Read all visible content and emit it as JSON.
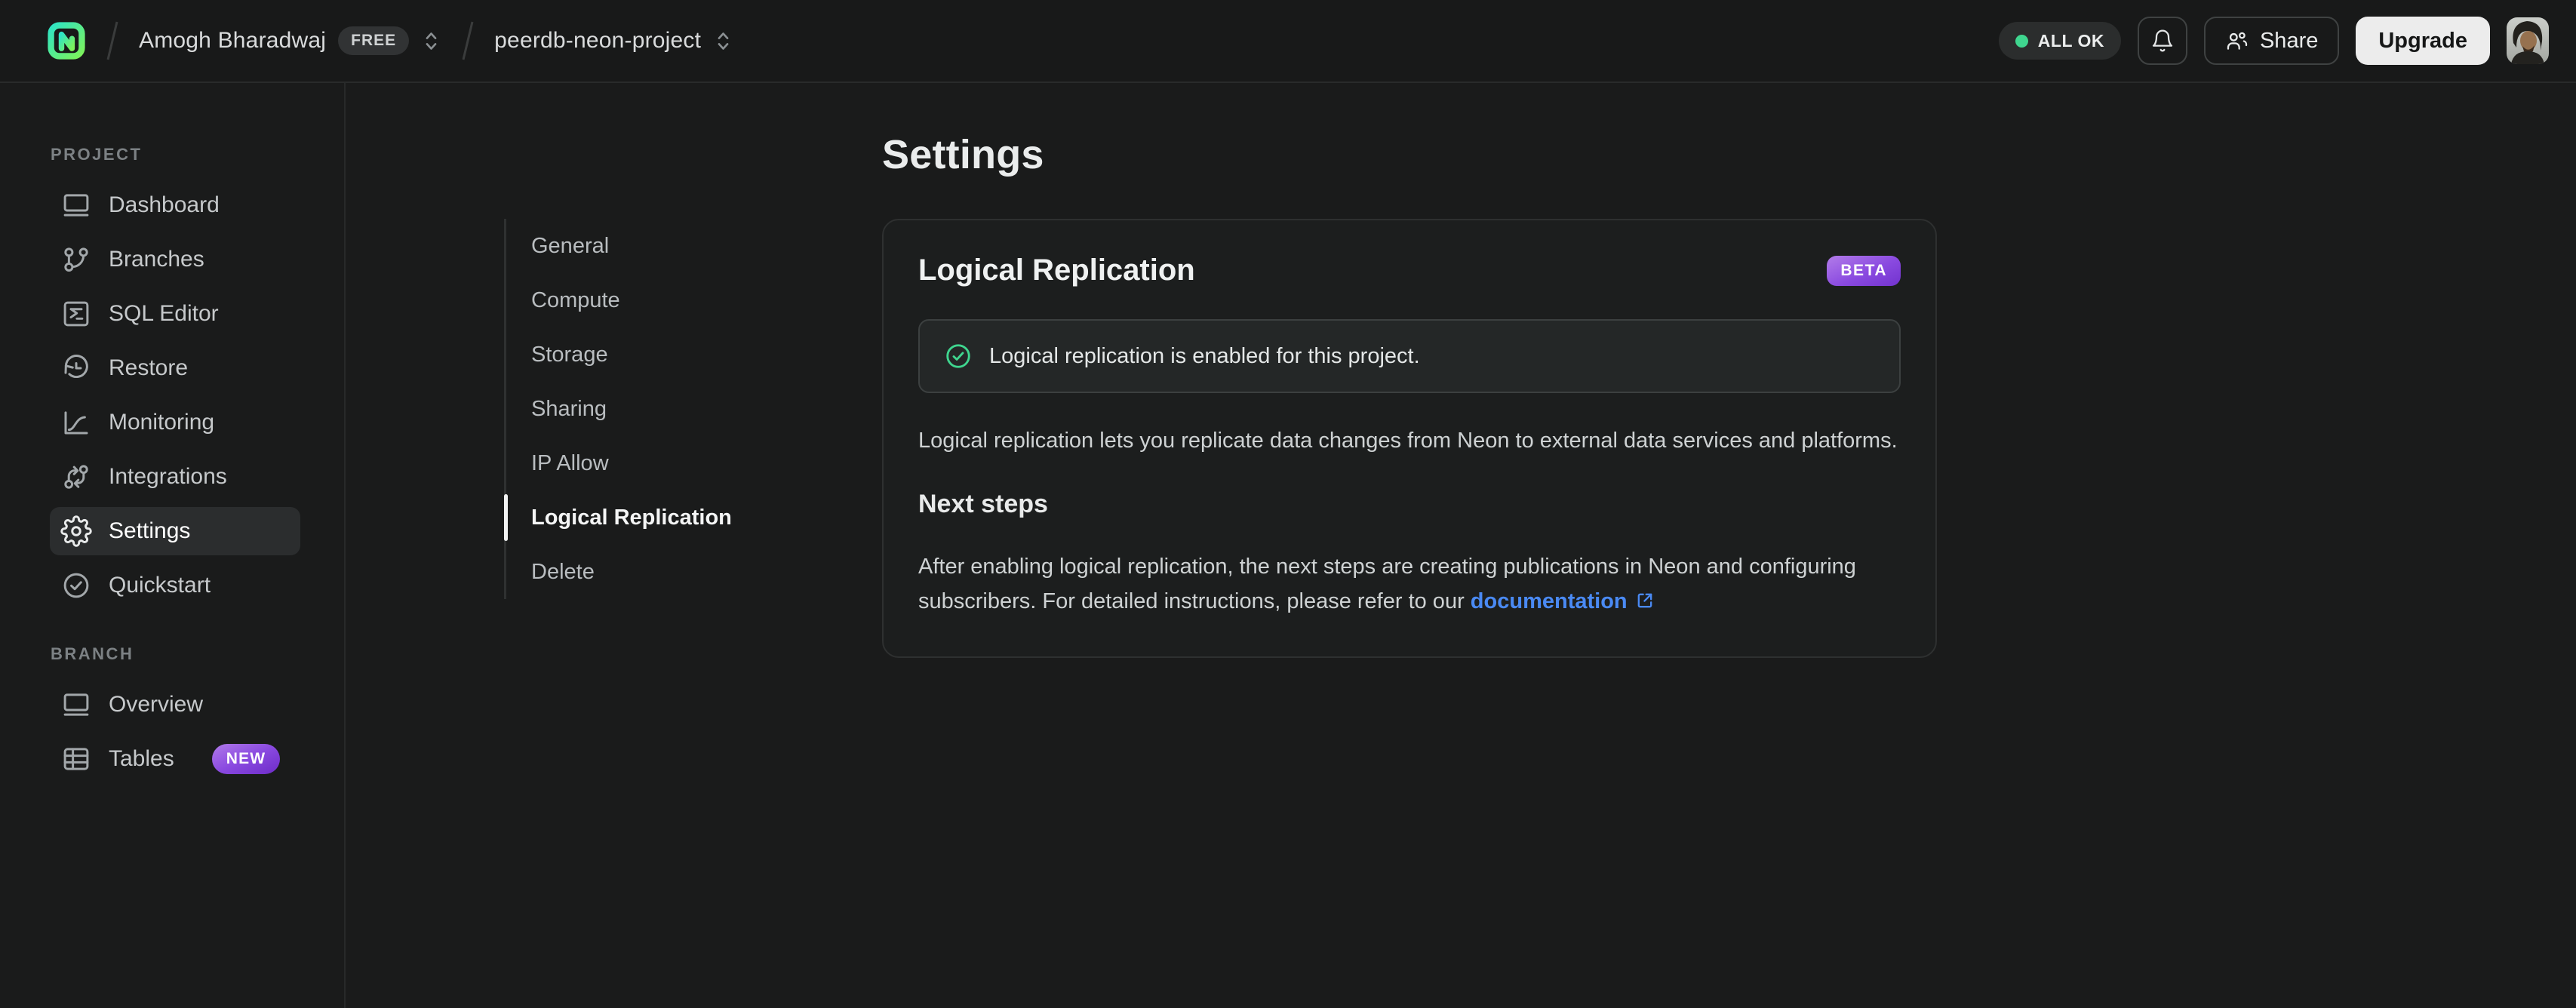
{
  "topbar": {
    "org": {
      "name": "Amogh Bharadwaj",
      "plan_badge": "FREE"
    },
    "project": {
      "name": "peerdb-neon-project"
    },
    "status": {
      "label": "ALL OK"
    },
    "share": {
      "label": "Share"
    },
    "upgrade": {
      "label": "Upgrade"
    }
  },
  "sidebar": {
    "project_section": {
      "label": "PROJECT",
      "items": [
        {
          "label": "Dashboard"
        },
        {
          "label": "Branches"
        },
        {
          "label": "SQL Editor"
        },
        {
          "label": "Restore"
        },
        {
          "label": "Monitoring"
        },
        {
          "label": "Integrations"
        },
        {
          "label": "Settings"
        },
        {
          "label": "Quickstart"
        }
      ]
    },
    "branch_section": {
      "label": "BRANCH",
      "items": [
        {
          "label": "Overview"
        },
        {
          "label": "Tables",
          "badge": "NEW"
        }
      ]
    }
  },
  "settings_nav": {
    "items": [
      {
        "label": "General"
      },
      {
        "label": "Compute"
      },
      {
        "label": "Storage"
      },
      {
        "label": "Sharing"
      },
      {
        "label": "IP Allow"
      },
      {
        "label": "Logical Replication"
      },
      {
        "label": "Delete"
      }
    ]
  },
  "main": {
    "page_title": "Settings",
    "card": {
      "title": "Logical Replication",
      "badge": "BETA",
      "alert_text": "Logical replication is enabled for this project.",
      "description": "Logical replication lets you replicate data changes from Neon to external data services and platforms.",
      "next_steps": {
        "title": "Next steps",
        "text": "After enabling logical replication, the next steps are creating publications in Neon and configuring subscribers. For detailed instructions, please refer to our",
        "link_label": "documentation"
      }
    }
  },
  "colors": {
    "accent_green": "#3fd68f",
    "link_blue": "#4a8af4",
    "badge_purple_start": "#b07ae9",
    "badge_purple_end": "#6d2bc8"
  }
}
